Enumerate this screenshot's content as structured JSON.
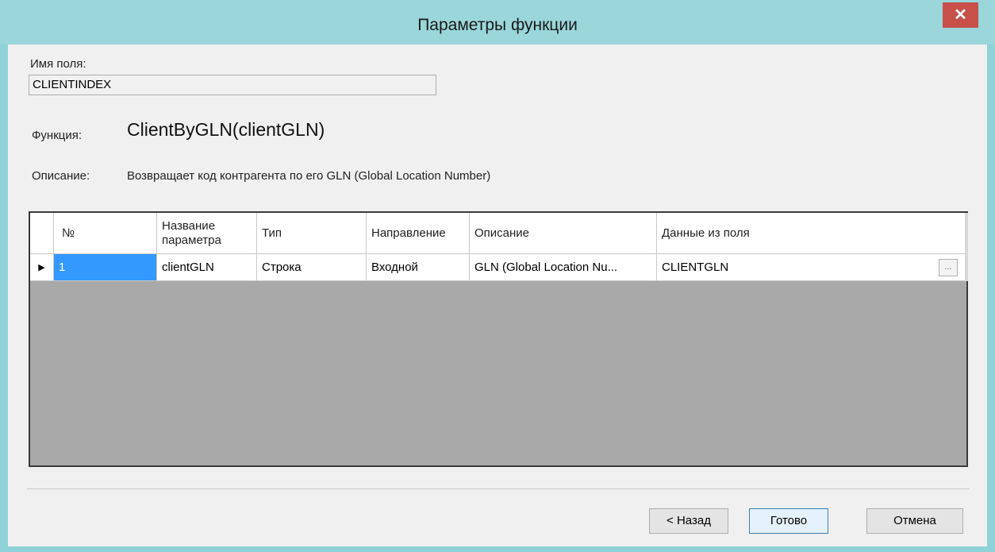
{
  "window": {
    "title": "Параметры функции",
    "close_glyph": "✕"
  },
  "form": {
    "field_label": "Имя поля:",
    "field_value": "CLIENTINDEX",
    "function_label": "Функция:",
    "function_name": "ClientByGLN(clientGLN)",
    "description_label": "Описание:",
    "description_text": "Возвращает код контрагента по его GLN (Global Location Number)"
  },
  "grid": {
    "headers": {
      "num": "№",
      "name_line1": "Название",
      "name_line2": "параметра",
      "type": "Тип",
      "direction": "Направление",
      "description": "Описание",
      "field_data": "Данные из поля"
    },
    "rows": [
      {
        "indicator": "▶",
        "num": "1",
        "name": "clientGLN",
        "type": "Строка",
        "direction": "Входной",
        "description": "GLN (Global Location Nu...",
        "field_data": "CLIENTGLN",
        "ellipsis": "..."
      }
    ]
  },
  "buttons": {
    "back": "< Назад",
    "finish": "Готово",
    "cancel": "Отмена"
  }
}
